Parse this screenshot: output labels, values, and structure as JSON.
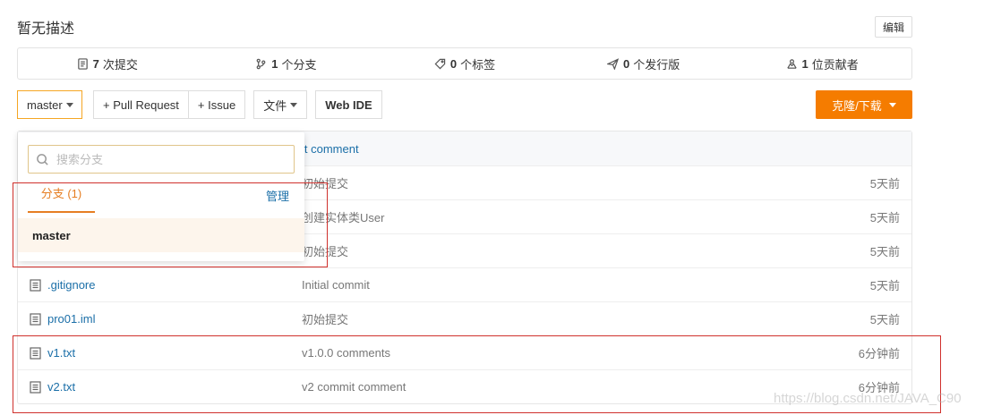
{
  "repo": {
    "description": "暂无描述",
    "edit_label": "编辑"
  },
  "stats": [
    {
      "icon": "commit-icon",
      "count": "7",
      "label": "次提交"
    },
    {
      "icon": "branch-icon",
      "count": "1",
      "label": "个分支"
    },
    {
      "icon": "tag-icon",
      "count": "0",
      "label": "个标签"
    },
    {
      "icon": "release-icon",
      "count": "0",
      "label": "个发行版"
    },
    {
      "icon": "contributors-icon",
      "count": "1",
      "label": "位贡献者"
    }
  ],
  "toolbar": {
    "branch": "master",
    "pull_request": "+ Pull Request",
    "issue": "+ Issue",
    "files": "文件",
    "web_ide": "Web IDE",
    "clone": "克隆/下载"
  },
  "files": {
    "header_message": "it comment",
    "rows": [
      {
        "name": "",
        "message": "初始提交",
        "time": "5天前"
      },
      {
        "name": "",
        "message": "创建实体类User",
        "time": "5天前"
      },
      {
        "name": "",
        "message": "初始提交",
        "time": "5天前"
      },
      {
        "name": ".gitignore",
        "message": "Initial commit",
        "time": "5天前"
      },
      {
        "name": "pro01.iml",
        "message": "初始提交",
        "time": "5天前"
      },
      {
        "name": "v1.txt",
        "message": "v1.0.0 comments",
        "time": "6分钟前"
      },
      {
        "name": "v2.txt",
        "message": "v2 commit comment",
        "time": "6分钟前"
      }
    ]
  },
  "branch_dropdown": {
    "search_placeholder": "搜索分支",
    "tab_label": "分支 (1)",
    "manage_label": "管理",
    "items": [
      "master"
    ]
  },
  "watermark": "https://blog.csdn.net/JAVA_C90",
  "colors": {
    "accent": "#f57c00",
    "link": "#1b6fa8",
    "highlight_box": "#d0312d"
  }
}
